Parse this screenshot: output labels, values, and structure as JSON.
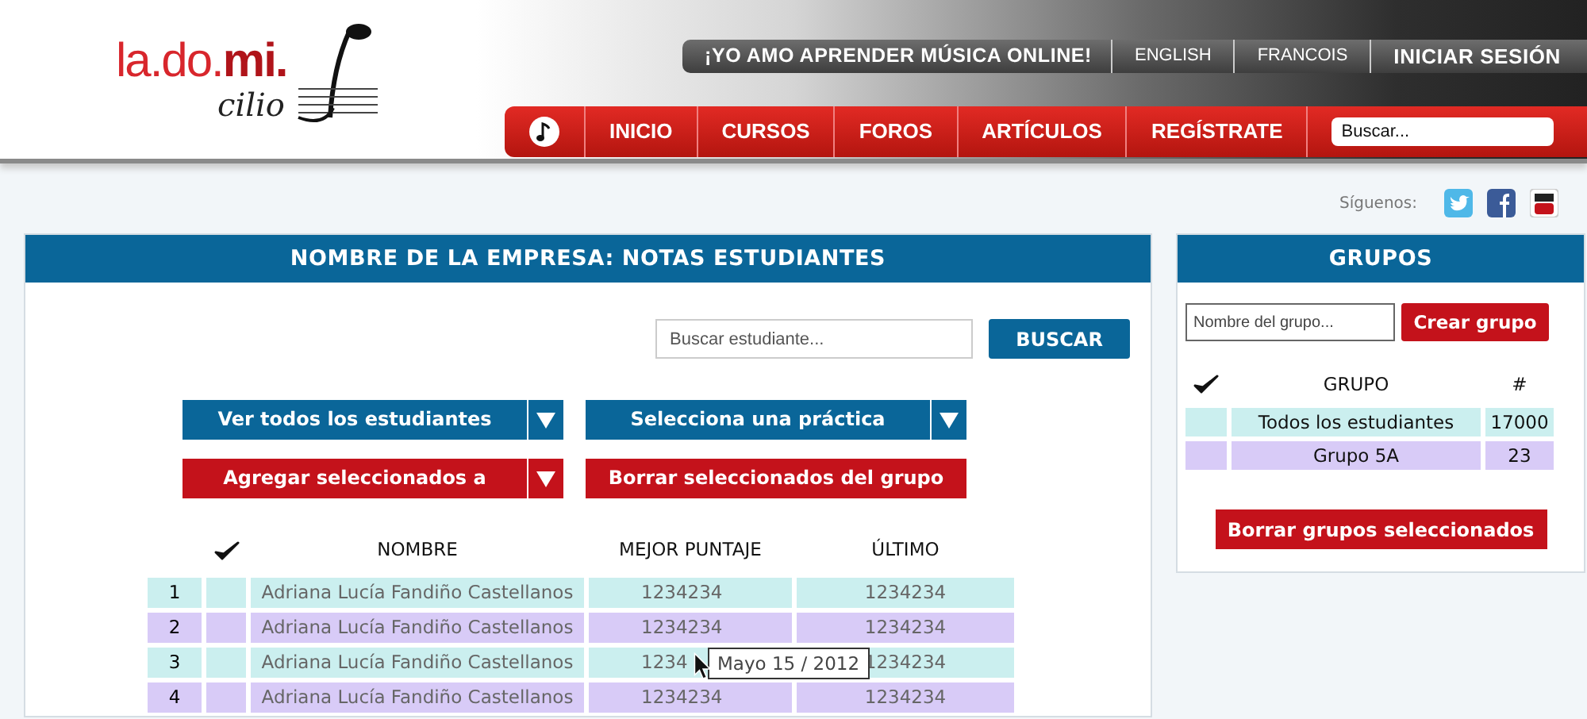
{
  "logo": {
    "line1": "la.do.**mi.**",
    "line2": "cilio"
  },
  "top_links": [
    {
      "label": "¡YO AMO APRENDER MÚSICA ONLINE!",
      "kind": "slogan"
    },
    {
      "label": "ENGLISH",
      "kind": "lang"
    },
    {
      "label": "FRANCOIS",
      "kind": "lang"
    },
    {
      "label": "INICIAR SESIÓN",
      "kind": "login"
    }
  ],
  "nav": {
    "items": [
      "INICIO",
      "CURSOS",
      "FOROS",
      "ARTÍCULOS",
      "REGÍSTRATE"
    ],
    "search": {
      "placeholder": "Buscar..."
    }
  },
  "social": {
    "label": "Síguenos:"
  },
  "main_panel": {
    "title": "NOMBRE DE LA EMPRESA: NOTAS ESTUDIANTES",
    "search": {
      "placeholder": "Buscar estudiante...",
      "button": "BUSCAR"
    },
    "actions": [
      {
        "label": "Ver todos los estudiantes",
        "kind": "dropdown",
        "color": "#0a6699"
      },
      {
        "label": "Selecciona una práctica",
        "kind": "dropdown",
        "color": "#0a6699"
      },
      {
        "label": "Agregar seleccionados a",
        "kind": "dropdown",
        "color": "#c4121b"
      },
      {
        "label": "Borrar seleccionados del grupo",
        "kind": "button",
        "color": "#c4121b"
      }
    ],
    "table": {
      "columns": [
        "NOMBRE",
        "MEJOR PUNTAJE",
        "ÚLTIMO"
      ],
      "rows": [
        {
          "number": "1",
          "name": "Adriana Lucía Fandiño Castellanos",
          "best": "1234234",
          "last": "1234234"
        },
        {
          "number": "2",
          "name": "Adriana Lucía Fandiño Castellanos",
          "best": "1234234",
          "last": "1234234"
        },
        {
          "number": "3",
          "name": "Adriana Lucía Fandiño Castellanos",
          "best": "1234",
          "last": "1234234"
        },
        {
          "number": "4",
          "name": "Adriana Lucía Fandiño Castellanos",
          "best": "1234234",
          "last": "1234234"
        }
      ]
    },
    "tooltip": {
      "text": "Mayo 15 / 2012"
    }
  },
  "groups_panel": {
    "title": "GRUPOS",
    "input": {
      "placeholder": "Nombre del grupo..."
    },
    "create_button": "Crear grupo",
    "columns": [
      "GRUPO",
      "#"
    ],
    "rows": [
      {
        "name": "Todos los estudiantes",
        "count": "17000"
      },
      {
        "name": "Grupo 5A",
        "count": "23"
      }
    ],
    "delete_button": "Borrar grupos seleccionados"
  }
}
